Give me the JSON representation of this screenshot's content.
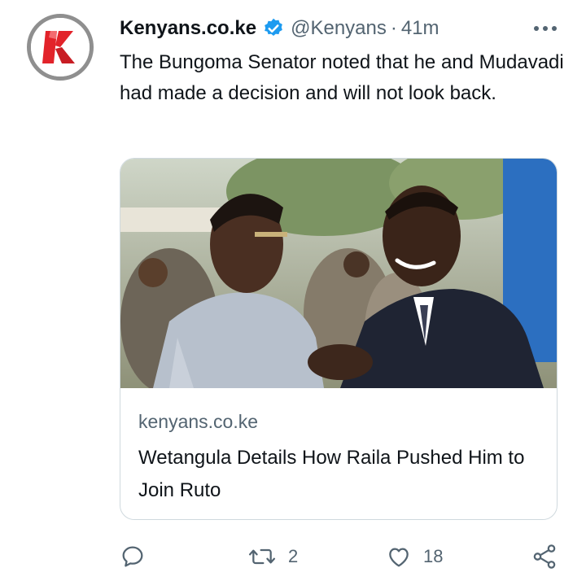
{
  "account": {
    "name": "Kenyans.co.ke",
    "handle": "@Kenyans",
    "separator": "·",
    "time": "41m",
    "logo_letter": "K"
  },
  "tweet": {
    "text": "The Bungoma Senator noted that he and Mudavadi had made a decision and will not look back."
  },
  "card": {
    "domain": "kenyans.co.ke",
    "title": "Wetangula Details How Raila Pushed Him to Join Ruto"
  },
  "actions": {
    "reply_count": "",
    "retweet_count": "2",
    "like_count": "18"
  },
  "colors": {
    "verified": "#1d9bf0",
    "logo_red": "#e2232a",
    "muted": "#536471"
  }
}
